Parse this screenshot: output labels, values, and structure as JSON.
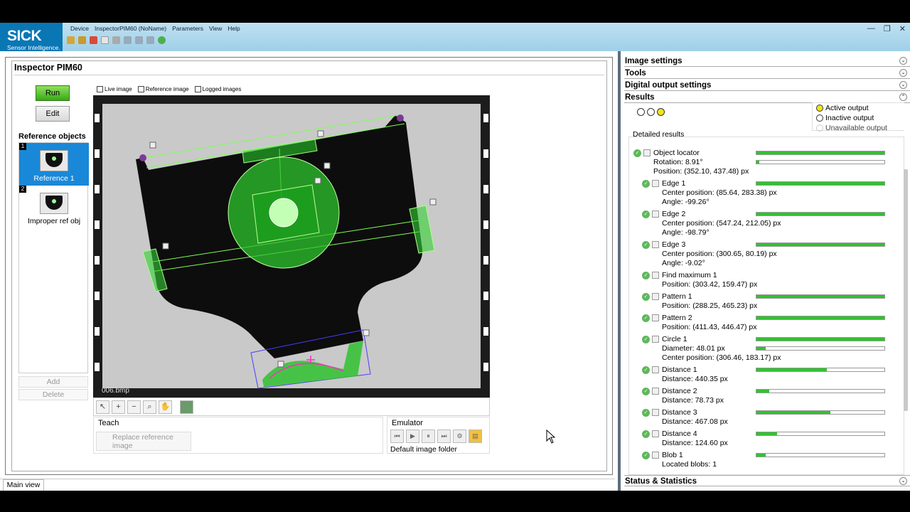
{
  "app": {
    "logo_main": "SICK",
    "logo_sub": "Sensor Intelligence.",
    "menu": [
      "Device",
      "InspectorPIM60 (NoName)",
      "Parameters",
      "View",
      "Help"
    ]
  },
  "main": {
    "title": "Inspector PIM60",
    "run_label": "Run",
    "edit_label": "Edit",
    "ref_header": "Reference objects",
    "refs": [
      {
        "num": "1",
        "label": "Reference 1"
      },
      {
        "num": "2",
        "label": "Improper ref obj"
      }
    ],
    "add_label": "Add",
    "delete_label": "Delete",
    "tabs": [
      "Live image",
      "Reference image",
      "Logged images"
    ],
    "filename": "006.bmp",
    "teach_header": "Teach",
    "replace_label": "Replace reference image",
    "emulator_header": "Emulator",
    "emulator_folder": "Default image folder",
    "main_view_tab": "Main view"
  },
  "right": {
    "sections": [
      "Image settings",
      "Tools",
      "Digital output settings",
      "Results"
    ],
    "status_section": "Status & Statistics",
    "legend": [
      "Active output",
      "Inactive output",
      "Unavailable output"
    ],
    "detailed_header": "Detailed results",
    "items": [
      {
        "name": "Object locator",
        "lines": [
          "Rotation: 8.91°",
          "Position: (352.10, 437.48) px"
        ],
        "bars": [
          1.0,
          0.02
        ]
      },
      {
        "name": "Edge 1",
        "lines": [
          "Center position: (85.64, 283.38) px",
          "Angle: -99.26°"
        ],
        "bars": [
          1.0
        ]
      },
      {
        "name": "Edge 2",
        "lines": [
          "Center position: (547.24, 212.05) px",
          "Angle: -98.79°"
        ],
        "bars": [
          1.0
        ]
      },
      {
        "name": "Edge 3",
        "lines": [
          "Center position: (300.65, 80.19) px",
          "Angle: -9.02°"
        ],
        "bars": [
          1.0
        ]
      },
      {
        "name": "Find maximum 1",
        "lines": [
          "Position: (303.42, 159.47) px"
        ],
        "bars": []
      },
      {
        "name": "Pattern 1",
        "lines": [
          "Position: (288.25, 465.23) px"
        ],
        "bars": [
          1.0
        ]
      },
      {
        "name": "Pattern 2",
        "lines": [
          "Position: (411.43, 446.47) px"
        ],
        "bars": [
          1.0
        ]
      },
      {
        "name": "Circle 1",
        "lines": [
          "Diameter: 48.01 px",
          "Center position: (306.46, 183.17) px"
        ],
        "bars": [
          1.0,
          0.07
        ]
      },
      {
        "name": "Distance 1",
        "lines": [
          "Distance: 440.35 px"
        ],
        "bars": [
          0.55
        ]
      },
      {
        "name": "Distance 2",
        "lines": [
          "Distance: 78.73 px"
        ],
        "bars": [
          0.1
        ]
      },
      {
        "name": "Distance 3",
        "lines": [
          "Distance: 467.08 px"
        ],
        "bars": [
          0.58
        ]
      },
      {
        "name": "Distance 4",
        "lines": [
          "Distance: 124.60 px"
        ],
        "bars": [
          0.16
        ]
      },
      {
        "name": "Blob 1",
        "lines": [
          "Located blobs: 1"
        ],
        "bars": [
          0.07
        ]
      }
    ]
  }
}
